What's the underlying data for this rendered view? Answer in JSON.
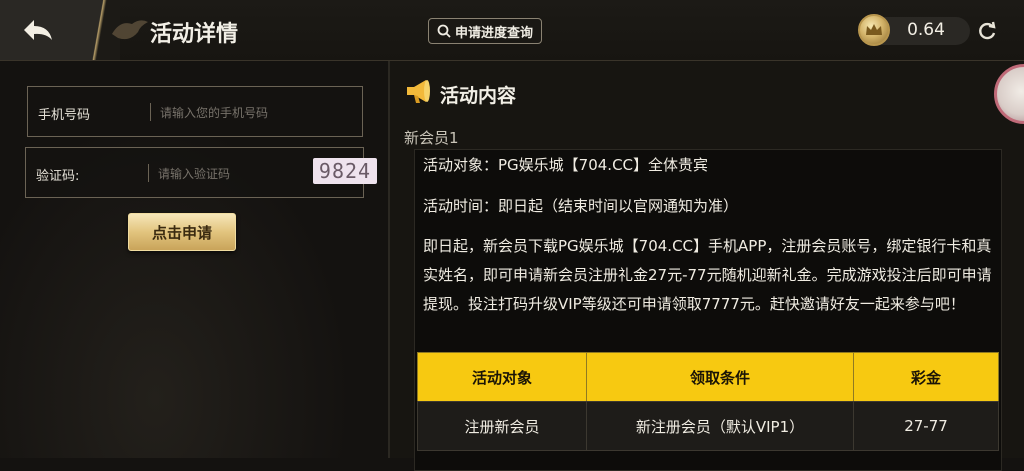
{
  "header": {
    "title": "活动详情",
    "progress_query_label": "申请进度查询",
    "balance": "0.64"
  },
  "form": {
    "phone_label": "手机号码",
    "phone_placeholder": "请输入您的手机号码",
    "code_label": "验证码:",
    "code_placeholder": "请输入验证码",
    "captcha": "9824",
    "apply_label": "点击申请"
  },
  "content": {
    "section_title": "活动内容",
    "subsection": "新会员1",
    "target_line": "活动对象：PG娱乐城【704.CC】全体贵宾",
    "time_line": "活动时间：即日起（结束时间以官网通知为准）",
    "description": "即日起，新会员下载PG娱乐城【704.CC】手机APP，注册会员账号，绑定银行卡和真实姓名，即可申请新会员注册礼金27元-77元随机迎新礼金。完成游戏投注后即可申请提现。投注打码升级VIP等级还可申请领取7777元。赶快邀请好友一起来参与吧！"
  },
  "table": {
    "headers": [
      "活动对象",
      "领取条件",
      "彩金"
    ],
    "rows": [
      [
        "注册新会员",
        "新注册会员（默认VIP1）",
        "27-77"
      ]
    ]
  },
  "colors": {
    "accent_gold": "#f7c911",
    "background": "#141210"
  },
  "icons": [
    "back-arrow-icon",
    "search-icon",
    "coin-crown-icon",
    "refresh-icon",
    "megaphone-icon"
  ]
}
